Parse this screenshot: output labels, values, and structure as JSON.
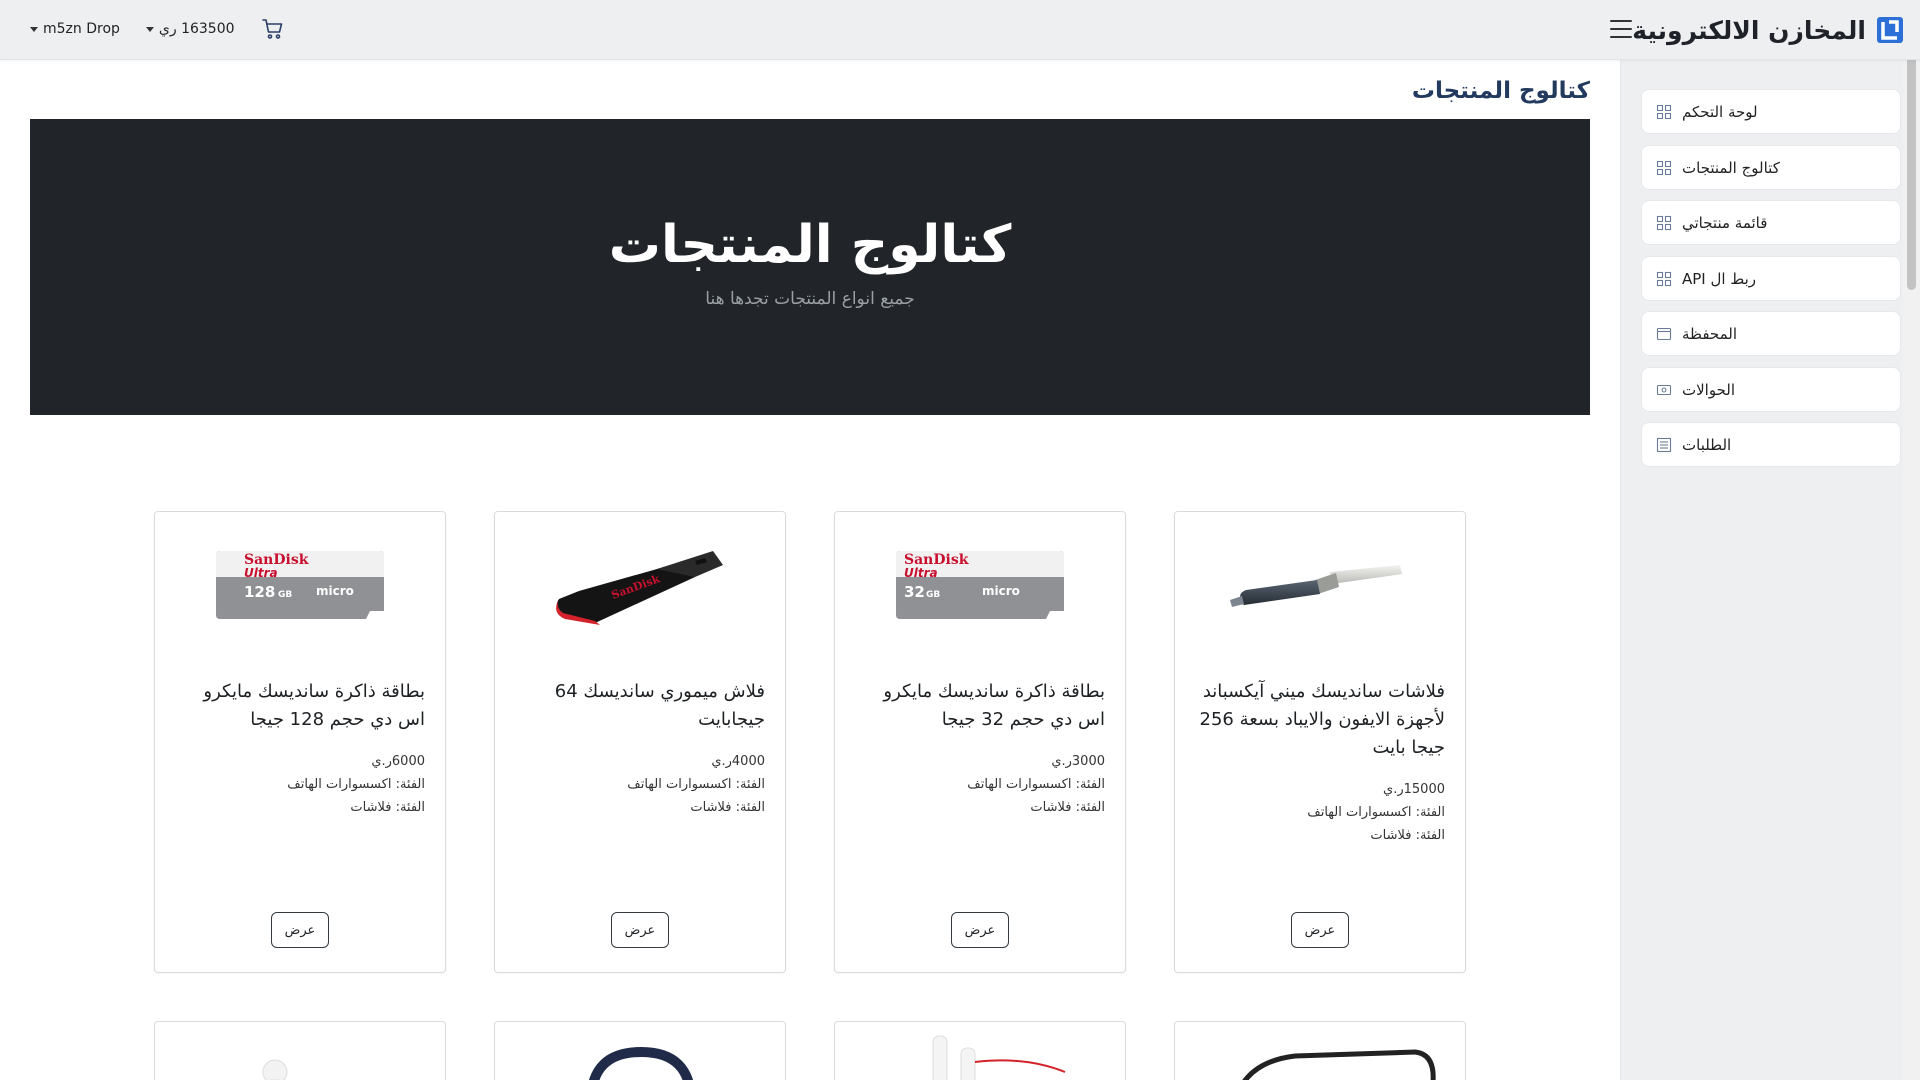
{
  "header": {
    "brand": "المخازن الالكترونية",
    "balance": "163500 ري",
    "account": "m5zn Drop"
  },
  "sidebar": {
    "items": [
      {
        "label": "لوحة التحكم",
        "icon": "grid-icon"
      },
      {
        "label": "كتالوج المنتجات",
        "icon": "grid-icon"
      },
      {
        "label": "قائمة منتجاتي",
        "icon": "grid-icon"
      },
      {
        "label": "ربط ال API",
        "icon": "grid-icon"
      },
      {
        "label": "المحفظة",
        "icon": "wallet-icon"
      },
      {
        "label": "الحوالات",
        "icon": "cash-icon"
      },
      {
        "label": "الطلبات",
        "icon": "list-icon"
      }
    ]
  },
  "main": {
    "page_title": "كتالوج المنتجات",
    "hero_title": "كتالوج المنتجات",
    "hero_subtitle": "جميع انواع المنتجات تجدها هنا"
  },
  "products": [
    {
      "title": "فلاشات سانديسك ميني آيكسباند لأجهزة الايفون والايباد بسعة 256 جيجا بايت",
      "price": "15000ر.ي",
      "category1": "الفئة: اكسسوارات الهاتف",
      "category2": "الفئة: فلاشات",
      "button": "عرض",
      "image": "ixpand-flash-drive"
    },
    {
      "title": "بطاقة ذاكرة سانديسك مايكرو اس دي حجم 32 جيجا",
      "price": "3000ر.ي",
      "category1": "الفئة: اكسسوارات الهاتف",
      "category2": "الفئة: فلاشات",
      "button": "عرض",
      "image": "sandisk-microsd-32"
    },
    {
      "title": "فلاش ميموري سانديسك 64 جيجابايت",
      "price": "4000ر.ي",
      "category1": "الفئة: اكسسوارات الهاتف",
      "category2": "الفئة: فلاشات",
      "button": "عرض",
      "image": "sandisk-cruzer-blade"
    },
    {
      "title": "بطاقة ذاكرة سانديسك مايكرو اس دي حجم 128 جيجا",
      "price": "6000ر.ي",
      "category1": "الفئة: اكسسوارات الهاتف",
      "category2": "الفئة: فلاشات",
      "button": "عرض",
      "image": "sandisk-microsd-128"
    }
  ],
  "sd_labels": {
    "brand": "SanDisk",
    "line": "Ultra",
    "size_32": "32",
    "size_128": "128",
    "unit": "GB",
    "micro": "micro"
  },
  "colors": {
    "accent": "#223a5e",
    "hero_bg": "#212529",
    "sidebar_bg": "#eeeff1",
    "logo_blue": "#2c6fd6"
  }
}
